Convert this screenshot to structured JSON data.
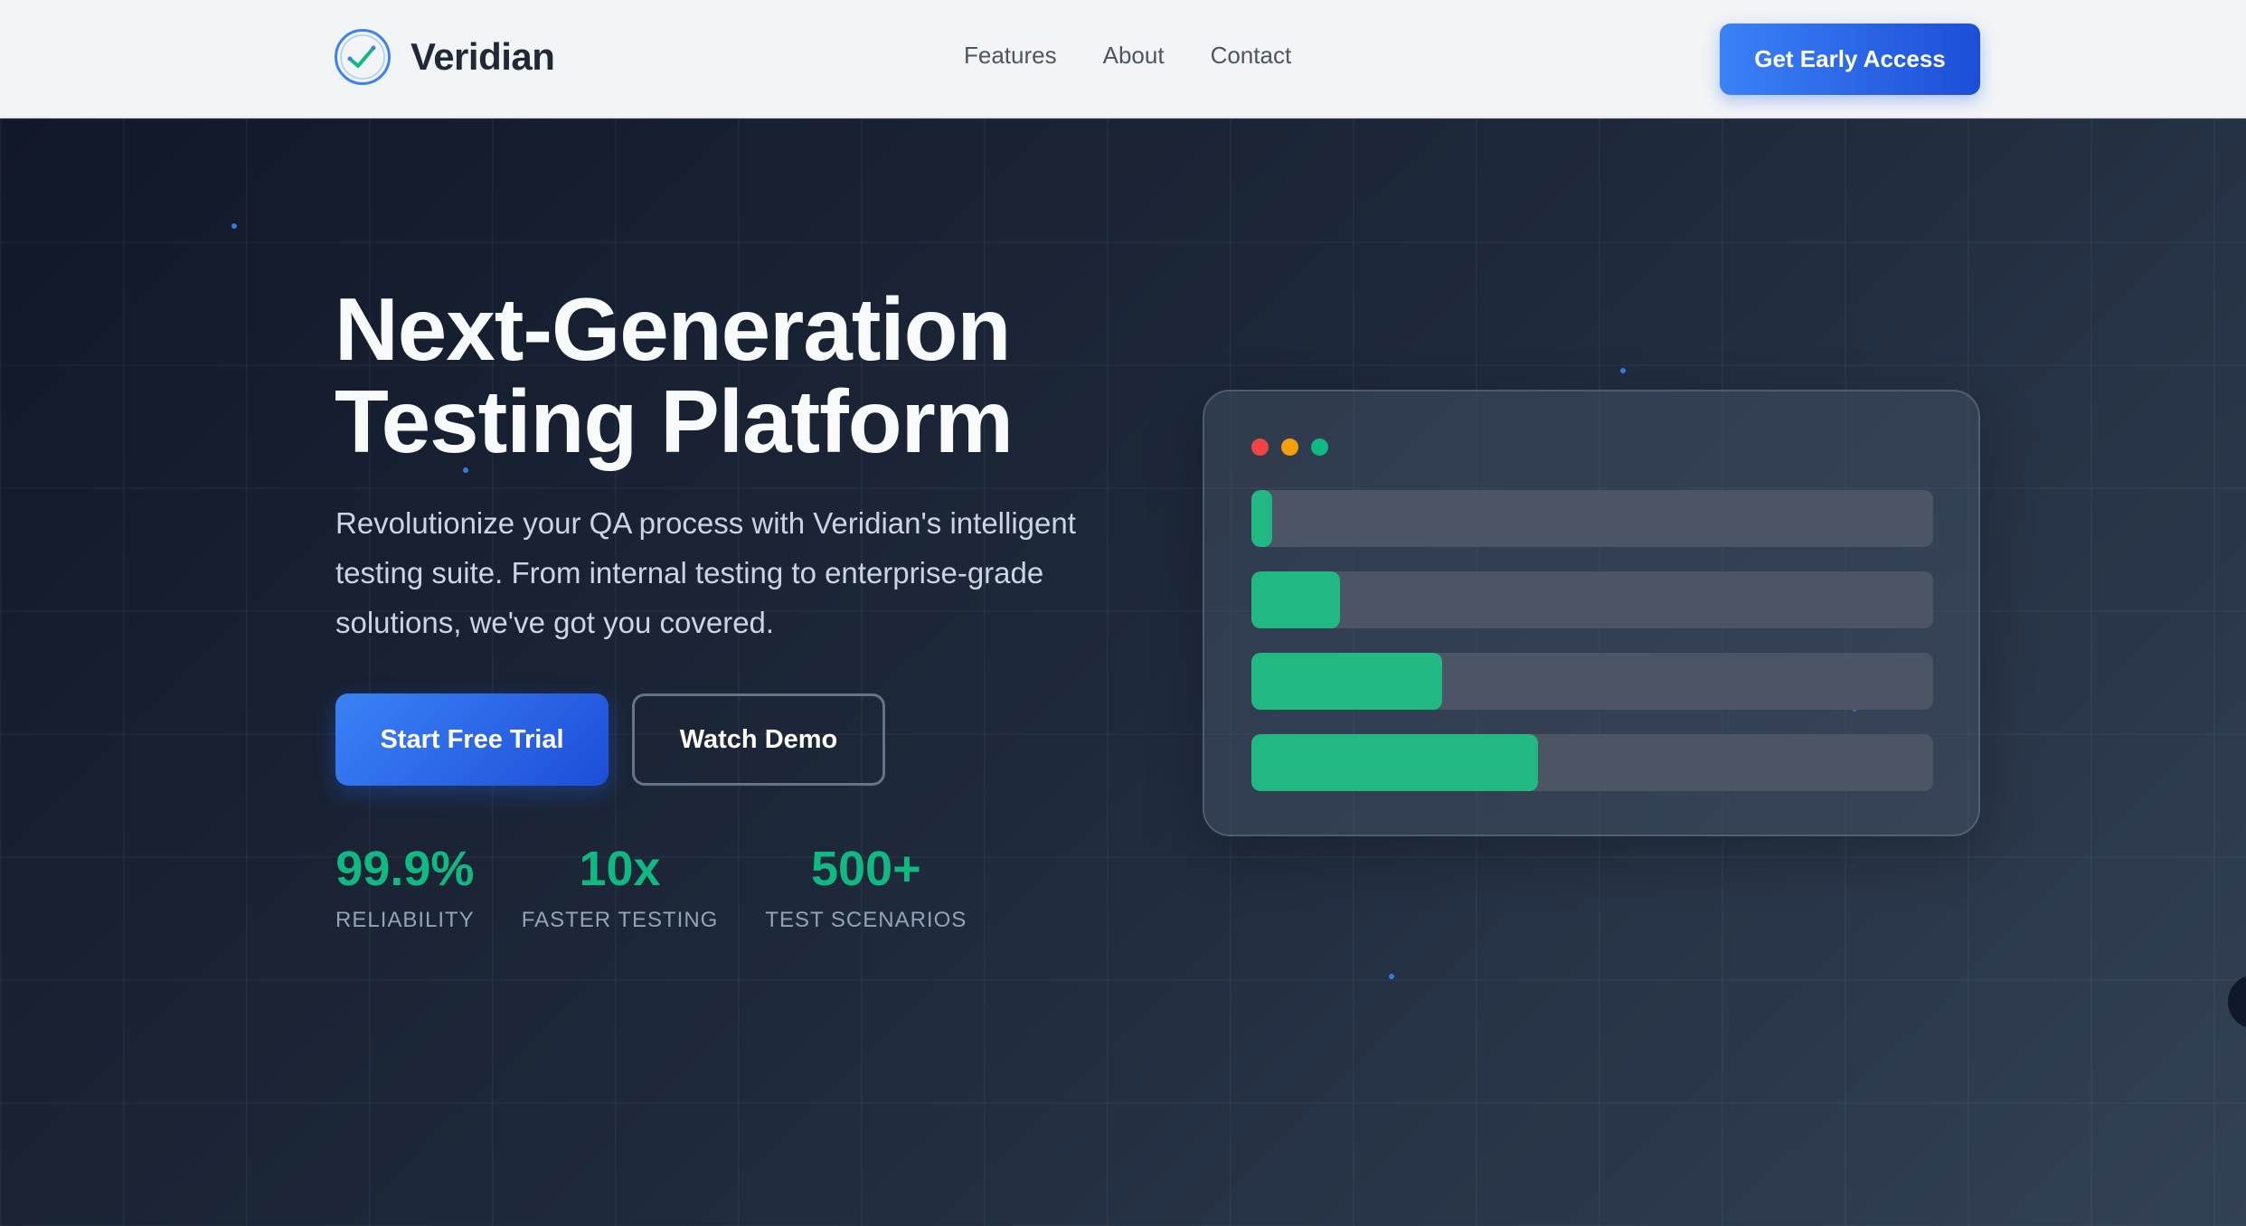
{
  "nav": {
    "brand": "Veridian",
    "links": [
      "Features",
      "About",
      "Contact"
    ],
    "cta": "Get Early Access"
  },
  "hero": {
    "title_line1": "Next-Generation",
    "title_line2": "Testing Platform",
    "subtitle": "Revolutionize your QA process with Veridian's intelligent testing suite. From internal testing to enterprise-grade solutions, we've got you covered.",
    "primary_cta": "Start Free Trial",
    "secondary_cta": "Watch Demo",
    "stats": [
      {
        "value": "99.9%",
        "label": "RELIABILITY"
      },
      {
        "value": "10x",
        "label": "FASTER TESTING"
      },
      {
        "value": "500+",
        "label": "TEST SCENARIOS"
      }
    ]
  },
  "card": {
    "window_dots": [
      "#ef4444",
      "#f59e0b",
      "#10b981"
    ],
    "progress_fractions": [
      0.03,
      0.13,
      0.28,
      0.42
    ]
  },
  "colors": {
    "accent": "#3b82f6",
    "success": "#10b981"
  }
}
